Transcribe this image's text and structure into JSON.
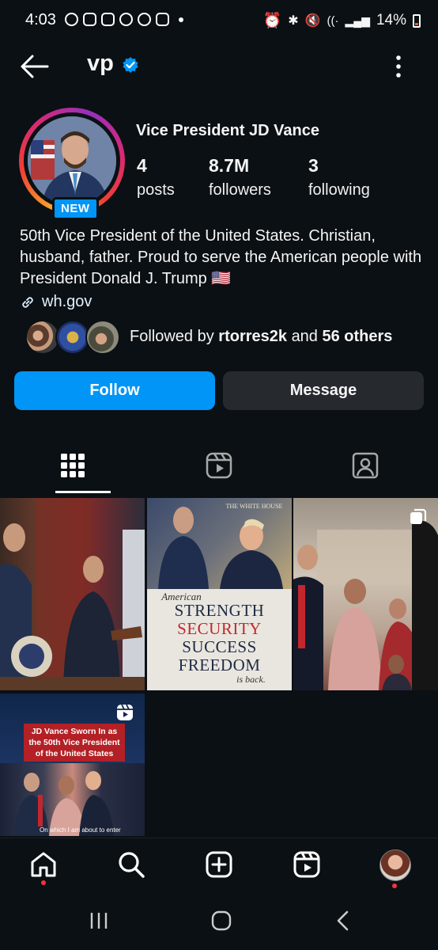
{
  "status_bar": {
    "time": "4:03",
    "battery": "14%"
  },
  "header": {
    "handle": "vp"
  },
  "profile": {
    "name": "Vice President JD Vance",
    "badge": "NEW",
    "stats": [
      {
        "value": "4",
        "label": "posts"
      },
      {
        "value": "8.7M",
        "label": "followers"
      },
      {
        "value": "3",
        "label": "following"
      }
    ],
    "bio": "50th Vice President of the United States. Christian, husband, father. Proud to serve the American people with President Donald J. Trump 🇺🇸",
    "link": "wh.gov",
    "followed_by": {
      "prefix": "Followed by",
      "user": "rtorres2k",
      "joiner": "and",
      "others": "56 others"
    }
  },
  "buttons": {
    "follow": "Follow",
    "message": "Message"
  },
  "tabs": [
    {
      "icon": "grid-icon",
      "active": true
    },
    {
      "icon": "reels-icon",
      "active": false
    },
    {
      "icon": "tagged-icon",
      "active": false
    }
  ],
  "posts": [
    {
      "id": "post-1",
      "overlay": null
    },
    {
      "id": "post-2",
      "poster": {
        "header": "THE WHITE HOUSE",
        "american": "American",
        "lines": [
          "STRENGTH",
          "SECURITY",
          "SUCCESS",
          "FREEDOM"
        ],
        "footer": "is back."
      }
    },
    {
      "id": "post-3",
      "overlay": "carousel-icon"
    },
    {
      "id": "post-4",
      "overlay": "reels-icon",
      "title": "JD Vance Sworn In as the 50th Vice President of the United States",
      "caption": "On which I am about to enter"
    }
  ],
  "bottom_nav": [
    "home-icon",
    "search-icon",
    "create-icon",
    "reels-icon",
    "profile-avatar"
  ],
  "colors": {
    "accent": "#0095f6",
    "background": "#0b1014",
    "notification": "#ff3040"
  }
}
